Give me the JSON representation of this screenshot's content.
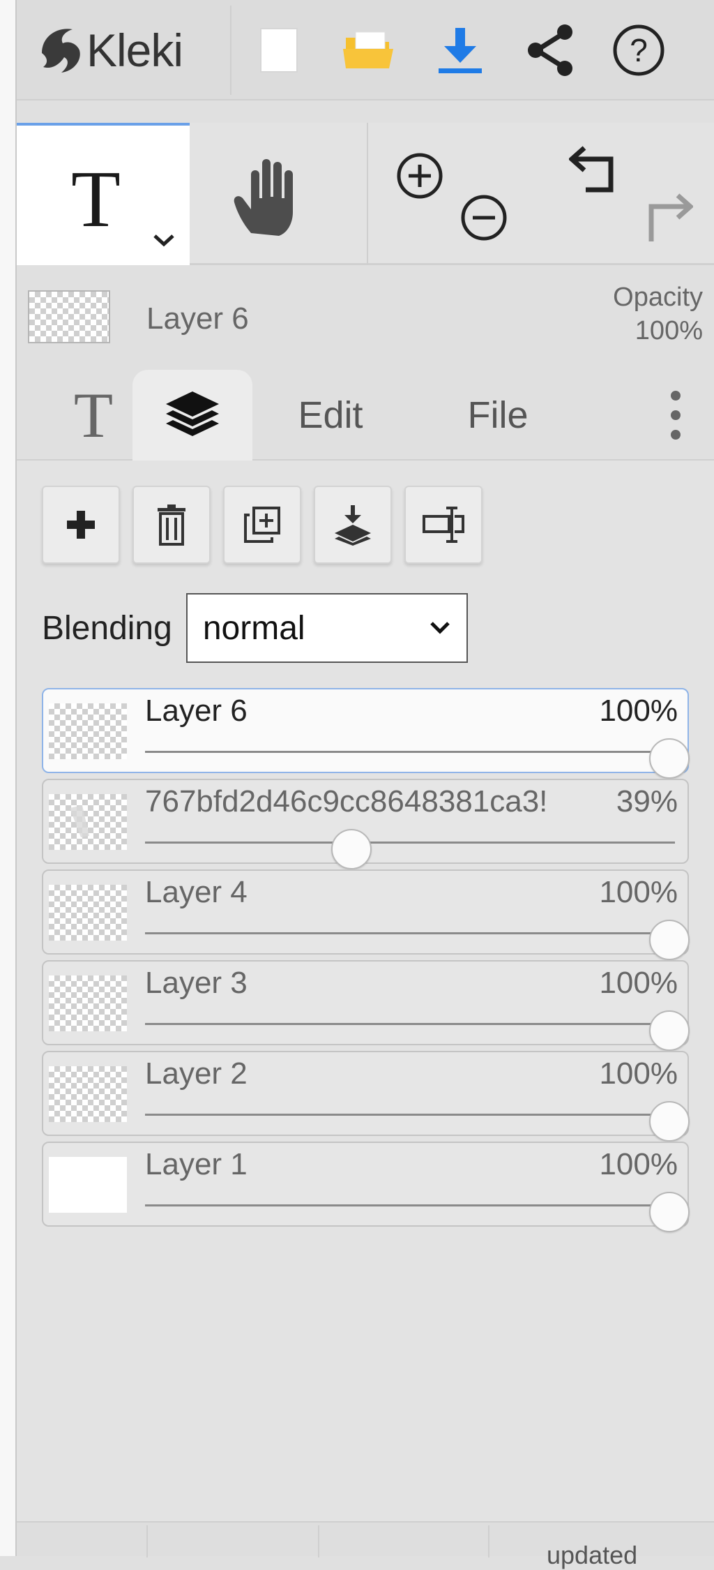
{
  "app": {
    "name": "Kleki"
  },
  "topbar": {
    "icons": [
      "new-image-icon",
      "open-folder-icon",
      "download-icon",
      "share-icon",
      "help-icon"
    ],
    "colors": {
      "folder": "#f6c02e",
      "download": "#1f7be6"
    }
  },
  "tools": {
    "active_tool_glyph": "T",
    "items": [
      "text-tool",
      "hand-tool",
      "zoom-in",
      "zoom-out",
      "undo",
      "redo"
    ]
  },
  "layer_info": {
    "name": "Layer 6",
    "opacity_label": "Opacity",
    "opacity_value": "100%"
  },
  "tabs": {
    "brush_glyph": "T",
    "layers_icon": "layers-icon",
    "edit": "Edit",
    "file": "File"
  },
  "layer_actions": [
    "add-layer",
    "delete-layer",
    "duplicate-layer",
    "merge-down",
    "rename-layer"
  ],
  "blending": {
    "label": "Blending",
    "value": "normal"
  },
  "layers": [
    {
      "name": "Layer 6",
      "opacity": "100%",
      "opacity_fraction": 1.0,
      "active": true
    },
    {
      "name": "767bfd2d46c9cc8648381ca3!",
      "opacity": "39%",
      "opacity_fraction": 0.39,
      "active": false
    },
    {
      "name": "Layer 4",
      "opacity": "100%",
      "opacity_fraction": 1.0,
      "active": false
    },
    {
      "name": "Layer 3",
      "opacity": "100%",
      "opacity_fraction": 1.0,
      "active": false
    },
    {
      "name": "Layer 2",
      "opacity": "100%",
      "opacity_fraction": 1.0,
      "active": false
    },
    {
      "name": "Layer 1",
      "opacity": "100%",
      "opacity_fraction": 1.0,
      "active": false
    }
  ],
  "footer": {
    "text": "updated"
  }
}
